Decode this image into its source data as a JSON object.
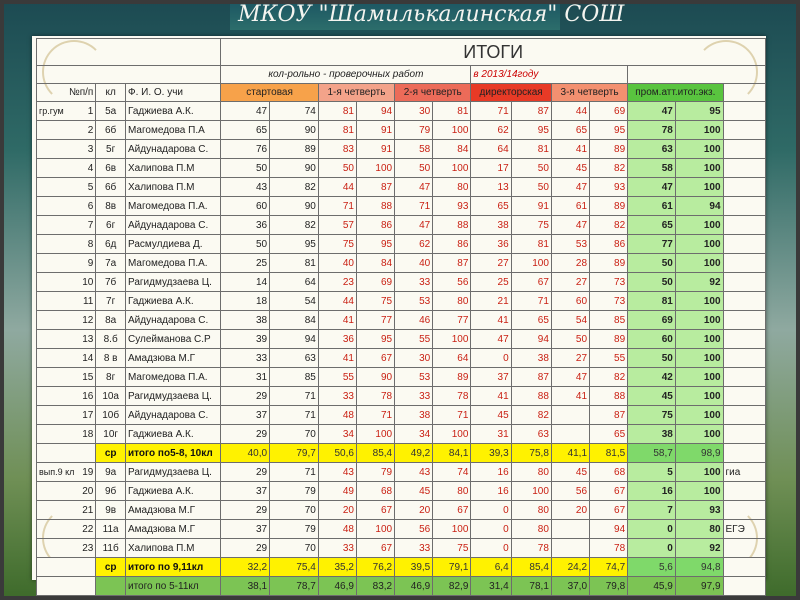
{
  "banner": {
    "title": "МКОУ \"Шамилькалинская\" СОШ"
  },
  "sheet": {
    "title": "ИТОГИ",
    "subtitle": "кол-рольно - проверочных работ",
    "year": "в 2013/14году",
    "columns": {
      "num": "№п/п",
      "cls": "кл",
      "teacher": "Ф.   И.   О. учи",
      "start": "стартовая",
      "q1": "1-я четверть",
      "q2": "2-я четверть",
      "dir": "директорская",
      "q3": "3-я четверть",
      "prom": "пром.атт.итог.экз."
    },
    "side_labels": {
      "group1": "гр.гум",
      "group2": "вып.9 кл",
      "group3": "",
      "note1": "гиа",
      "note2": "ЕГЭ"
    },
    "rows": [
      {
        "n": "1",
        "cls": "5а",
        "t": "Гаджиева А.К.",
        "v": [
          "47",
          "74",
          "81",
          "94",
          "30",
          "81",
          "71",
          "87",
          "44",
          "69",
          "47",
          "95"
        ]
      },
      {
        "n": "2",
        "cls": "6б",
        "t": "Магомедова П.А",
        "v": [
          "65",
          "90",
          "81",
          "91",
          "79",
          "100",
          "62",
          "95",
          "65",
          "95",
          "78",
          "100"
        ]
      },
      {
        "n": "3",
        "cls": "5г",
        "t": "Айдунадарова С.",
        "v": [
          "76",
          "89",
          "83",
          "91",
          "58",
          "84",
          "64",
          "81",
          "41",
          "89",
          "63",
          "100"
        ]
      },
      {
        "n": "4",
        "cls": "6в",
        "t": "Халипова П.М",
        "v": [
          "50",
          "90",
          "50",
          "100",
          "50",
          "100",
          "17",
          "50",
          "45",
          "82",
          "58",
          "100"
        ]
      },
      {
        "n": "5",
        "cls": "6б",
        "t": "Халипова П.М",
        "v": [
          "43",
          "82",
          "44",
          "87",
          "47",
          "80",
          "13",
          "50",
          "47",
          "93",
          "47",
          "100"
        ]
      },
      {
        "n": "6",
        "cls": "8в",
        "t": "Магомедова П.А.",
        "v": [
          "60",
          "90",
          "71",
          "88",
          "71",
          "93",
          "65",
          "91",
          "61",
          "89",
          "61",
          "94"
        ]
      },
      {
        "n": "7",
        "cls": "6г",
        "t": "Айдунадарова С.",
        "v": [
          "36",
          "82",
          "57",
          "86",
          "47",
          "88",
          "38",
          "75",
          "47",
          "82",
          "65",
          "100"
        ]
      },
      {
        "n": "8",
        "cls": "6д",
        "t": "Расмулдиева Д.",
        "v": [
          "50",
          "95",
          "75",
          "95",
          "62",
          "86",
          "36",
          "81",
          "53",
          "86",
          "77",
          "100"
        ]
      },
      {
        "n": "9",
        "cls": "7а",
        "t": "Магомедова П.А.",
        "v": [
          "25",
          "81",
          "40",
          "84",
          "40",
          "87",
          "27",
          "100",
          "28",
          "89",
          "50",
          "100"
        ]
      },
      {
        "n": "10",
        "cls": "7б",
        "t": "Рагидмудзаева Ц.",
        "v": [
          "14",
          "64",
          "23",
          "69",
          "33",
          "56",
          "25",
          "67",
          "27",
          "73",
          "50",
          "92"
        ]
      },
      {
        "n": "11",
        "cls": "7г",
        "t": "Гаджиева А.К.",
        "v": [
          "18",
          "54",
          "44",
          "75",
          "53",
          "80",
          "21",
          "71",
          "60",
          "73",
          "81",
          "100"
        ]
      },
      {
        "n": "12",
        "cls": "8а",
        "t": "Айдунадарова С.",
        "v": [
          "38",
          "84",
          "41",
          "77",
          "46",
          "77",
          "41",
          "65",
          "54",
          "85",
          "69",
          "100"
        ]
      },
      {
        "n": "13",
        "cls": "8.б",
        "t": "Сулейманова С.Р",
        "v": [
          "39",
          "94",
          "36",
          "95",
          "55",
          "100",
          "47",
          "94",
          "50",
          "89",
          "60",
          "100"
        ]
      },
      {
        "n": "14",
        "cls": "8 в",
        "t": "Амадзюва М.Г",
        "v": [
          "33",
          "63",
          "41",
          "67",
          "30",
          "64",
          "0",
          "38",
          "27",
          "55",
          "50",
          "100"
        ]
      },
      {
        "n": "15",
        "cls": "8г",
        "t": "Магомедова П.А.",
        "v": [
          "31",
          "85",
          "55",
          "90",
          "53",
          "89",
          "37",
          "87",
          "47",
          "82",
          "42",
          "100"
        ]
      },
      {
        "n": "16",
        "cls": "10а",
        "t": "Рагидмудзаева Ц.",
        "v": [
          "29",
          "71",
          "33",
          "78",
          "33",
          "78",
          "41",
          "88",
          "41",
          "88",
          "45",
          "100"
        ]
      },
      {
        "n": "17",
        "cls": "10б",
        "t": "Айдунадарова С.",
        "v": [
          "37",
          "71",
          "48",
          "71",
          "38",
          "71",
          "45",
          "82",
          "",
          "87",
          "75",
          "100"
        ]
      },
      {
        "n": "18",
        "cls": "10г",
        "t": "Гаджиева А.К.",
        "v": [
          "29",
          "70",
          "34",
          "100",
          "34",
          "100",
          "31",
          "63",
          "",
          "65",
          "38",
          "100"
        ]
      }
    ],
    "sum1": {
      "cls": "ср",
      "label": "итого по5-8, 10кл",
      "v": [
        "40,0",
        "79,7",
        "50,6",
        "85,4",
        "49,2",
        "84,1",
        "39,3",
        "75,8",
        "41,1",
        "81,5",
        "58,7",
        "98,9"
      ]
    },
    "rows2": [
      {
        "n": "19",
        "cls": "9а",
        "t": "Рагидмудзаева Ц.",
        "v": [
          "29",
          "71",
          "43",
          "79",
          "43",
          "74",
          "16",
          "80",
          "45",
          "68",
          "5",
          "100"
        ]
      },
      {
        "n": "20",
        "cls": "9б",
        "t": "Гаджиева А.К.",
        "v": [
          "37",
          "79",
          "49",
          "68",
          "45",
          "80",
          "16",
          "100",
          "56",
          "67",
          "16",
          "100"
        ]
      },
      {
        "n": "21",
        "cls": "9в",
        "t": "Амадзюва М.Г",
        "v": [
          "29",
          "70",
          "20",
          "67",
          "20",
          "67",
          "0",
          "80",
          "20",
          "67",
          "7",
          "93"
        ]
      },
      {
        "n": "22",
        "cls": "11а",
        "t": "Амадзюва М.Г",
        "v": [
          "37",
          "79",
          "48",
          "100",
          "56",
          "100",
          "0",
          "80",
          "",
          "94",
          "0",
          "80"
        ]
      },
      {
        "n": "23",
        "cls": "11б",
        "t": "Халипова П.М",
        "v": [
          "29",
          "70",
          "33",
          "67",
          "33",
          "75",
          "0",
          "78",
          "",
          "78",
          "0",
          "92"
        ]
      }
    ],
    "sum2": {
      "cls": "ср",
      "label": "итого по 9,11кл",
      "v": [
        "32,2",
        "75,4",
        "35,2",
        "76,2",
        "39,5",
        "79,1",
        "6,4",
        "85,4",
        "24,2",
        "74,7",
        "5,6",
        "94,8"
      ]
    },
    "sum3": {
      "cls": "",
      "label": "итого по 5-11кл",
      "v": [
        "38,1",
        "78,7",
        "46,9",
        "83,2",
        "46,9",
        "82,9",
        "31,4",
        "78,1",
        "37,0",
        "79,8",
        "45,9",
        "97,9"
      ]
    }
  }
}
